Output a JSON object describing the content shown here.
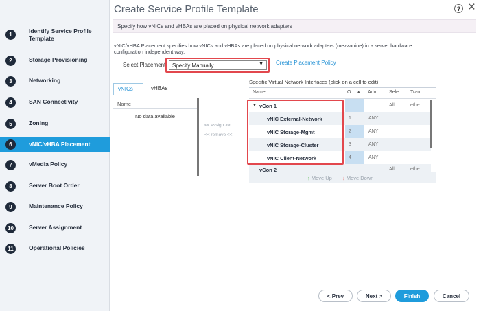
{
  "title": "Create Service Profile Template",
  "banner": "Specify how vNICs and vHBAs are placed on physical network adapters",
  "description": "vNIC/vHBA Placement specifies how vNICs and vHBAs are placed on physical network adapters (mezzanine) in a server hardware configuration independent way.",
  "steps": [
    {
      "num": "1",
      "label": "Identify Service Profile Template"
    },
    {
      "num": "2",
      "label": "Storage Provisioning"
    },
    {
      "num": "3",
      "label": "Networking"
    },
    {
      "num": "4",
      "label": "SAN Connectivity"
    },
    {
      "num": "5",
      "label": "Zoning"
    },
    {
      "num": "6",
      "label": "vNIC/vHBA Placement"
    },
    {
      "num": "7",
      "label": "vMedia Policy"
    },
    {
      "num": "8",
      "label": "Server Boot Order"
    },
    {
      "num": "9",
      "label": "Maintenance Policy"
    },
    {
      "num": "10",
      "label": "Server Assignment"
    },
    {
      "num": "11",
      "label": "Operational Policies"
    }
  ],
  "placement": {
    "label": "Select Placement:",
    "value": "Specify Manually",
    "link": "Create Placement Policy"
  },
  "tabs": {
    "vnics": "vNICs",
    "vhbas": "vHBAs"
  },
  "left_table": {
    "header": "Name",
    "empty": "No data available"
  },
  "assign": "<< assign >>",
  "remove": "<< remove <<",
  "right_title": "Specific Virtual Network Interfaces (click on a cell to edit)",
  "right_headers": {
    "name": "Name",
    "order": "O...",
    "admin": "Adm...",
    "sel": "Sele...",
    "trans": "Tran..."
  },
  "vcon1": {
    "name": "vCon 1",
    "sel": "All",
    "trans": "ethe..."
  },
  "vnics": [
    {
      "name": "vNIC External-Network",
      "order": "1",
      "admin": "ANY"
    },
    {
      "name": "vNIC Storage-Mgmt",
      "order": "2",
      "admin": "ANY"
    },
    {
      "name": "vNIC Storage-Cluster",
      "order": "3",
      "admin": "ANY"
    },
    {
      "name": "vNIC Client-Network",
      "order": "4",
      "admin": "ANY"
    }
  ],
  "vcon2": {
    "name": "vCon 2",
    "sel": "All",
    "trans": "ethe..."
  },
  "move_up": "Move Up",
  "move_down": "Move Down",
  "buttons": {
    "prev": "< Prev",
    "next": "Next >",
    "finish": "Finish",
    "cancel": "Cancel"
  },
  "colors": {
    "accent": "#1f9cdc",
    "highlight": "#e2474d",
    "sidebar": "#f0f3f7"
  }
}
